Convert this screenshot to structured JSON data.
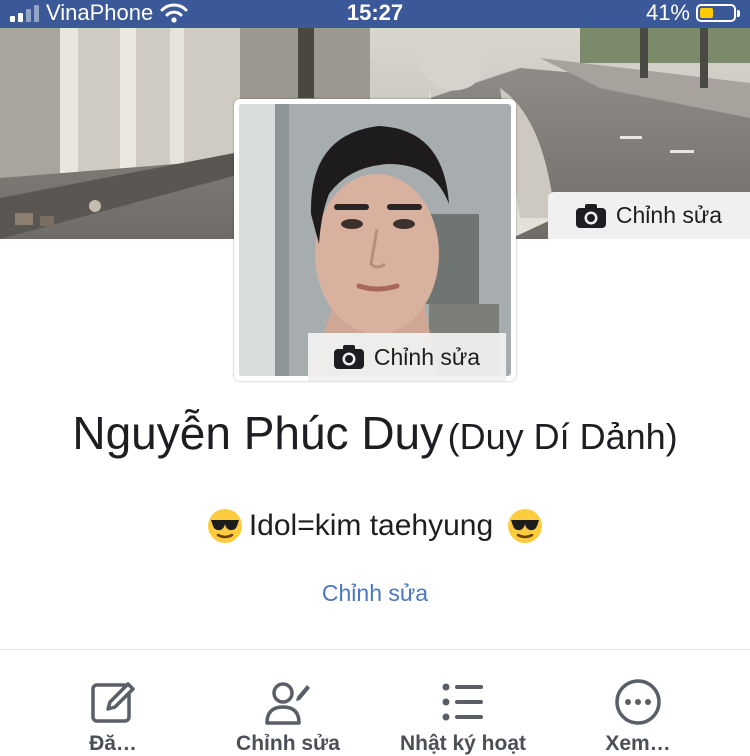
{
  "status_bar": {
    "carrier": "VinaPhone",
    "time": "15:27",
    "battery_percent": "41%",
    "battery_level": 0.41,
    "signal_bars": 2,
    "icons": [
      "signal-icon",
      "wifi-icon",
      "battery-icon"
    ]
  },
  "cover": {
    "edit_label": "Chỉnh sửa",
    "icon": "camera-icon"
  },
  "avatar": {
    "edit_label": "Chỉnh sửa",
    "icon": "camera-icon"
  },
  "profile": {
    "name": "Nguyễn Phúc Duy",
    "alt_name": "(Duy Dí Dảnh)",
    "bio_text": "Idol=kim taehyung",
    "bio_emoji": "sunglasses-emoji",
    "edit_bio_label": "Chỉnh sửa"
  },
  "actions": [
    {
      "label": "Đă…",
      "icon": "compose-icon"
    },
    {
      "label": "Chỉnh sửa",
      "icon": "edit-profile-icon"
    },
    {
      "label": "Nhật ký hoạt",
      "icon": "activity-list-icon"
    },
    {
      "label": "Xem…",
      "icon": "more-icon"
    }
  ],
  "colors": {
    "status_bar_bg": "#3b5998",
    "link_blue": "#4a76c6",
    "battery_yellow": "#ffcc00"
  }
}
